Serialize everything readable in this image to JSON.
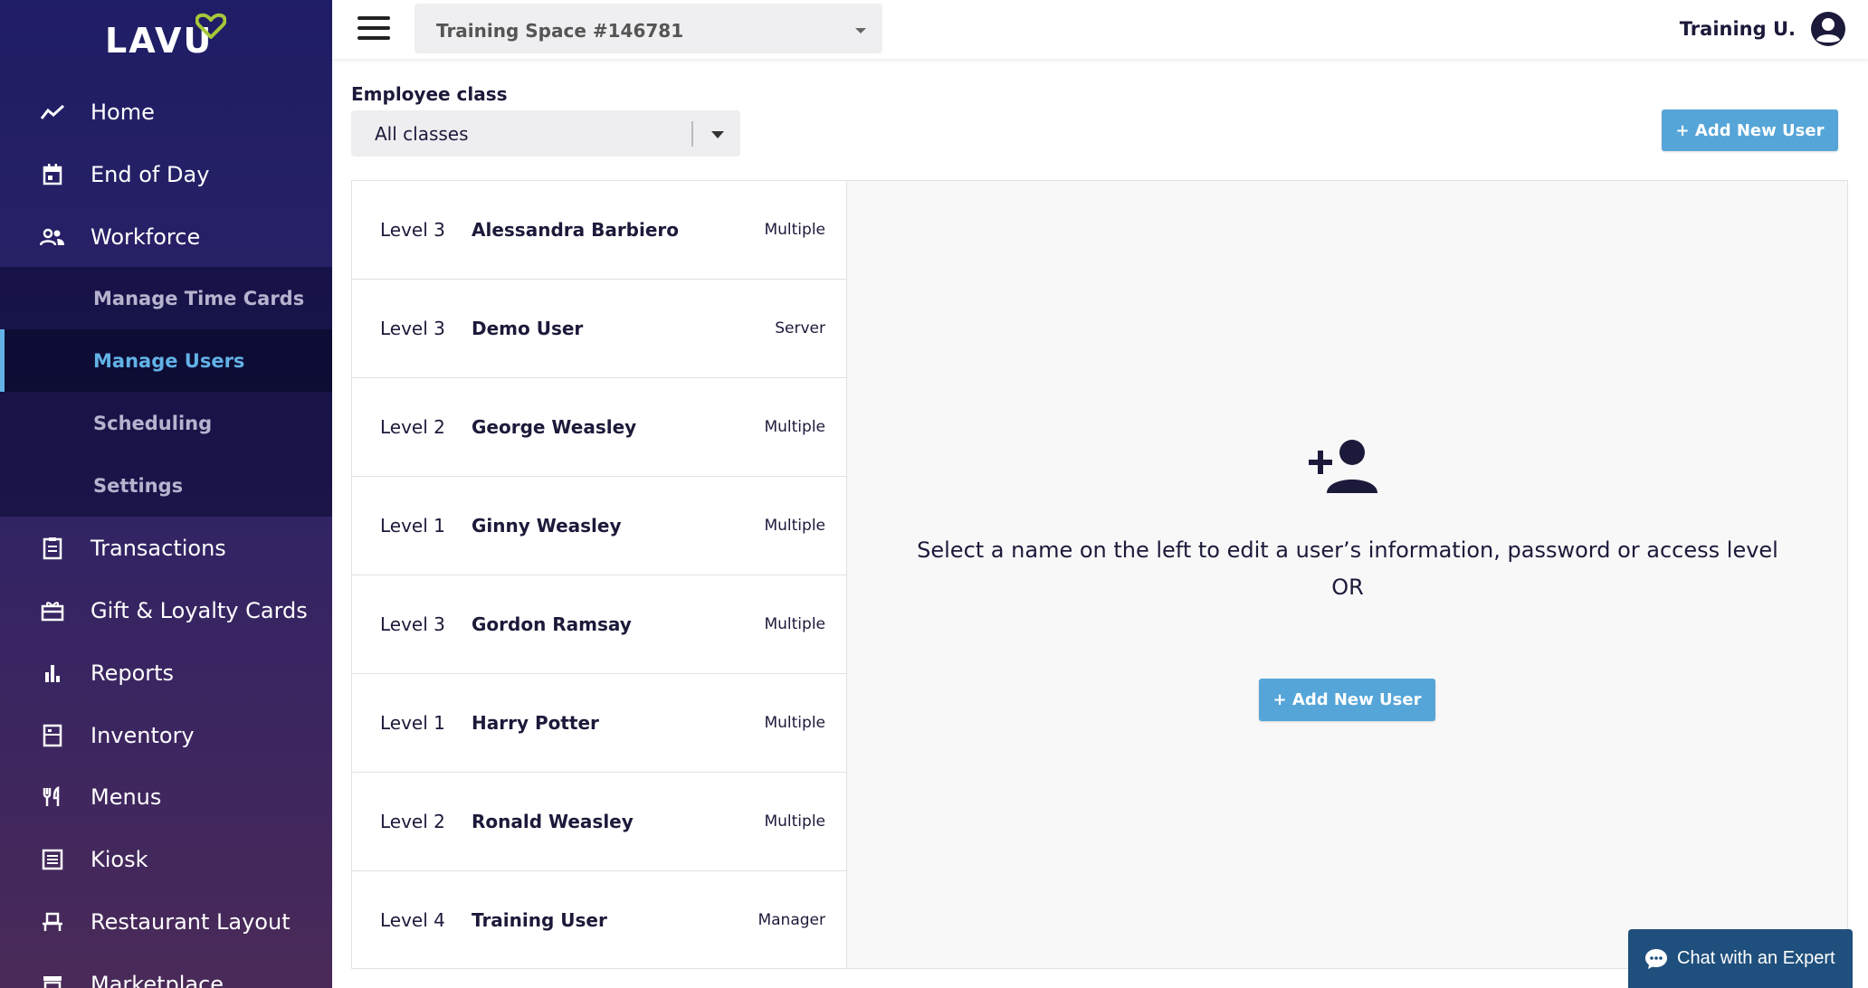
{
  "brand": {
    "logo_text": "LAVU"
  },
  "sidebar": {
    "items": [
      {
        "label": "Home",
        "icon": "trend-line-icon"
      },
      {
        "label": "End of Day",
        "icon": "calendar-icon"
      },
      {
        "label": "Workforce",
        "icon": "people-icon"
      },
      {
        "label": "Transactions",
        "icon": "receipt-icon"
      },
      {
        "label": "Gift & Loyalty Cards",
        "icon": "gift-card-icon"
      },
      {
        "label": "Reports",
        "icon": "bar-chart-icon"
      },
      {
        "label": "Inventory",
        "icon": "inventory-icon"
      },
      {
        "label": "Menus",
        "icon": "fork-knife-icon"
      },
      {
        "label": "Kiosk",
        "icon": "kiosk-icon"
      },
      {
        "label": "Restaurant Layout",
        "icon": "table-chair-icon"
      },
      {
        "label": "Marketplace",
        "icon": "store-icon"
      }
    ],
    "workforce_sub": [
      {
        "label": "Manage Time Cards"
      },
      {
        "label": "Manage Users",
        "active": true
      },
      {
        "label": "Scheduling"
      },
      {
        "label": "Settings"
      }
    ]
  },
  "topbar": {
    "space_select": "Training Space #146781",
    "user_name": "Training U."
  },
  "filters": {
    "employee_class_label": "Employee class",
    "employee_class_value": "All classes"
  },
  "actions": {
    "add_new_user": "+ Add New User"
  },
  "users": [
    {
      "level": "Level 3",
      "name": "Alessandra Barbiero",
      "class": "Multiple"
    },
    {
      "level": "Level 3",
      "name": "Demo User",
      "class": "Server"
    },
    {
      "level": "Level 2",
      "name": "George Weasley",
      "class": "Multiple"
    },
    {
      "level": "Level 1",
      "name": "Ginny Weasley",
      "class": "Multiple"
    },
    {
      "level": "Level 3",
      "name": "Gordon Ramsay",
      "class": "Multiple"
    },
    {
      "level": "Level 1",
      "name": "Harry Potter",
      "class": "Multiple"
    },
    {
      "level": "Level 2",
      "name": "Ronald Weasley",
      "class": "Multiple"
    },
    {
      "level": "Level 4",
      "name": "Training User",
      "class": "Manager"
    }
  ],
  "detail": {
    "message": "Select a name on the left to edit a user’s information, password or access level",
    "or": "OR"
  },
  "chat": {
    "label": "Chat with an Expert"
  },
  "colors": {
    "accent_blue": "#56a5d8",
    "sidebar_top": "#1f1d66",
    "sidebar_bottom": "#4a2a58",
    "logo_heart": "#a6c73a",
    "chat_bg": "#1f4f7c"
  }
}
